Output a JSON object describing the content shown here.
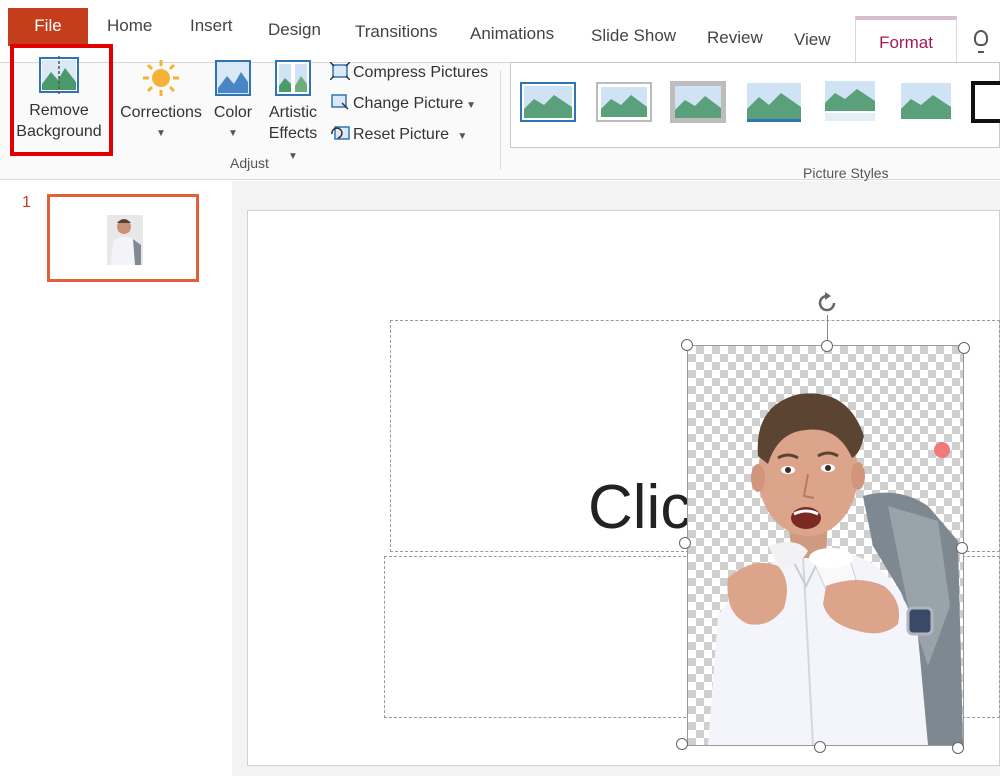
{
  "tabs": {
    "file": "File",
    "home": "Home",
    "insert": "Insert",
    "design": "Design",
    "transitions": "Transitions",
    "animations": "Animations",
    "slide_show": "Slide Show",
    "review": "Review",
    "view": "View",
    "format": "Format"
  },
  "ribbon": {
    "remove_background": {
      "line1": "Remove",
      "line2": "Background"
    },
    "corrections": "Corrections",
    "color": "Color",
    "artistic_effects": {
      "line1": "Artistic",
      "line2": "Effects"
    },
    "compress_pictures": "Compress Pictures",
    "change_picture": "Change Picture",
    "reset_picture": "Reset Picture",
    "adjust_group_label": "Adjust",
    "picture_styles_group_label": "Picture Styles"
  },
  "slides_pane": {
    "slide_number": "1"
  },
  "slide": {
    "title_placeholder_visible_text": "Clic"
  },
  "colors": {
    "file_tab_bg": "#c43e1c",
    "format_tab_text": "#a3195b",
    "highlight_border": "#e00000",
    "thumbnail_border": "#e0603a"
  }
}
